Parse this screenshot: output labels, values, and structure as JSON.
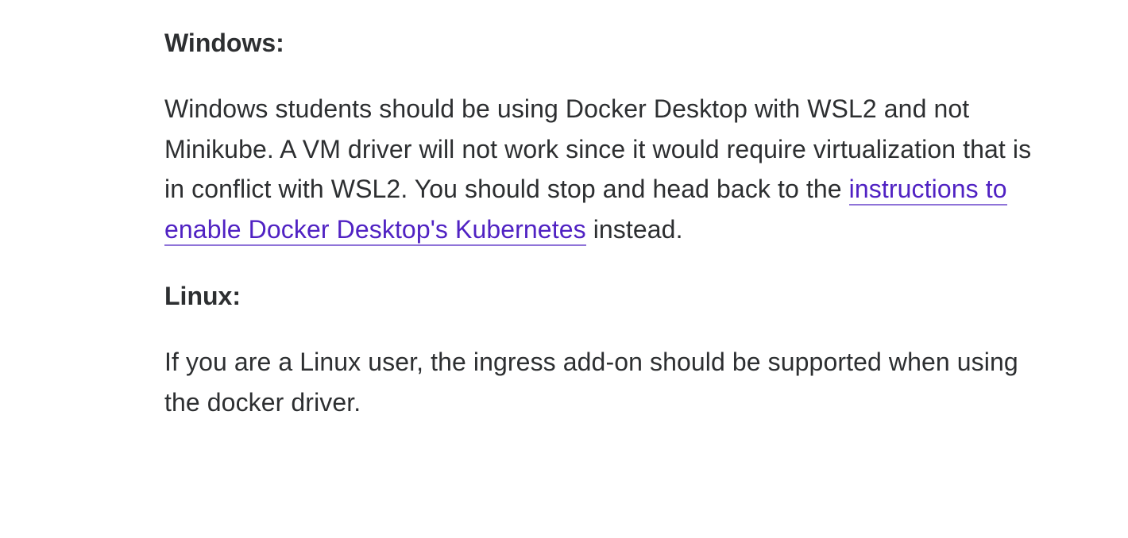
{
  "windows": {
    "heading": "Windows:",
    "text_before_link": "Windows students should be using Docker Desktop with WSL2 and not Minikube. A VM driver will not work since it would require virtualization that is in conflict with WSL2. You should stop and head back to the ",
    "link_text": "instructions to enable Docker Desktop's Kubernetes",
    "text_after_link": " instead."
  },
  "linux": {
    "heading": "Linux:",
    "text": "If you are a Linux user, the ingress add-on should be supported when using the docker driver."
  },
  "colors": {
    "text": "#2d2f31",
    "link": "#5022c3",
    "link_underline": "#8f73d8",
    "background": "#ffffff"
  }
}
